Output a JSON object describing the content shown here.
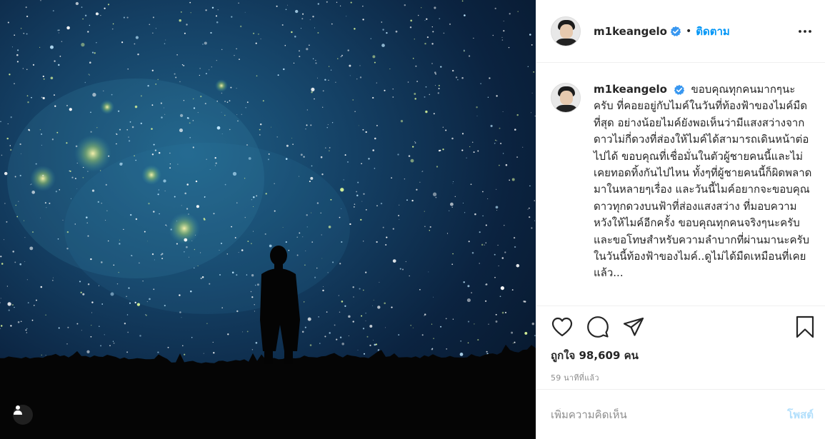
{
  "post": {
    "username": "m1keangelo",
    "verified": true,
    "follow_label": "ติดตาม",
    "separator": "•"
  },
  "caption": {
    "username": "m1keangelo",
    "text": "ขอบคุณทุกคนมากๆนะครับ ที่คอยอยู่กับไมค์ในวันที่ท้องฟ้าของไมค์มืดที่สุด อย่างน้อยไมค์ยังพอเห็นว่ามีแสงสว่างจากดาวไม่กี่ดวงที่ส่องให้ไมค์ได้สามารถเดินหน้าต่อไปได้ ขอบคุณที่เชื่อมั่นในตัวผู้ชายคนนี้และไม่เคยทอดทิ้งกันไปไหน ทั้งๆที่ผู้ชายคนนี้ก็ผิดพลาดมาในหลายๆเรื่อง และวันนี้ไมค์อยากจะขอบคุณดาวทุกดวงบนฟ้าที่ส่องแสงสว่าง ที่มอบความหวังให้ไมค์อีกครั้ง ขอบคุณทุกคนจริงๆนะครับ และขอโทษสำหรับความลำบากที่ผ่านมานะครับ ในวันนี้ท้องฟ้าของไมค์..ดูไม่ได้มืดเหมือนที่เคยแล้ว..."
  },
  "stats": {
    "likes": "ถูกใจ 98,609 คน",
    "time": "59 นาทีที่แล้ว"
  },
  "comment_box": {
    "placeholder": "เพิ่มความคิดเห็น",
    "post_label": "โพสต์"
  },
  "icons": {
    "verified": "verified-badge-icon",
    "more": "more-options-icon",
    "like": "heart-icon",
    "comment": "comment-bubble-icon",
    "share": "paper-plane-icon",
    "save": "bookmark-icon",
    "tag": "user-tag-icon"
  },
  "colors": {
    "accent": "#0095f6",
    "post_disabled": "#b2dffc",
    "muted": "#8e8e8e"
  }
}
